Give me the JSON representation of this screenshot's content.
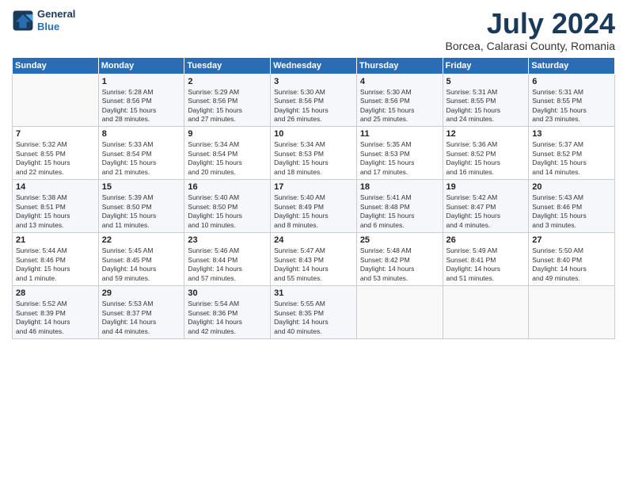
{
  "header": {
    "logo": {
      "line1": "General",
      "line2": "Blue"
    },
    "title": "July 2024",
    "subtitle": "Borcea, Calarasi County, Romania"
  },
  "weekdays": [
    "Sunday",
    "Monday",
    "Tuesday",
    "Wednesday",
    "Thursday",
    "Friday",
    "Saturday"
  ],
  "weeks": [
    [
      {
        "day": "",
        "info": ""
      },
      {
        "day": "1",
        "info": "Sunrise: 5:28 AM\nSunset: 8:56 PM\nDaylight: 15 hours\nand 28 minutes."
      },
      {
        "day": "2",
        "info": "Sunrise: 5:29 AM\nSunset: 8:56 PM\nDaylight: 15 hours\nand 27 minutes."
      },
      {
        "day": "3",
        "info": "Sunrise: 5:30 AM\nSunset: 8:56 PM\nDaylight: 15 hours\nand 26 minutes."
      },
      {
        "day": "4",
        "info": "Sunrise: 5:30 AM\nSunset: 8:56 PM\nDaylight: 15 hours\nand 25 minutes."
      },
      {
        "day": "5",
        "info": "Sunrise: 5:31 AM\nSunset: 8:55 PM\nDaylight: 15 hours\nand 24 minutes."
      },
      {
        "day": "6",
        "info": "Sunrise: 5:31 AM\nSunset: 8:55 PM\nDaylight: 15 hours\nand 23 minutes."
      }
    ],
    [
      {
        "day": "7",
        "info": "Sunrise: 5:32 AM\nSunset: 8:55 PM\nDaylight: 15 hours\nand 22 minutes."
      },
      {
        "day": "8",
        "info": "Sunrise: 5:33 AM\nSunset: 8:54 PM\nDaylight: 15 hours\nand 21 minutes."
      },
      {
        "day": "9",
        "info": "Sunrise: 5:34 AM\nSunset: 8:54 PM\nDaylight: 15 hours\nand 20 minutes."
      },
      {
        "day": "10",
        "info": "Sunrise: 5:34 AM\nSunset: 8:53 PM\nDaylight: 15 hours\nand 18 minutes."
      },
      {
        "day": "11",
        "info": "Sunrise: 5:35 AM\nSunset: 8:53 PM\nDaylight: 15 hours\nand 17 minutes."
      },
      {
        "day": "12",
        "info": "Sunrise: 5:36 AM\nSunset: 8:52 PM\nDaylight: 15 hours\nand 16 minutes."
      },
      {
        "day": "13",
        "info": "Sunrise: 5:37 AM\nSunset: 8:52 PM\nDaylight: 15 hours\nand 14 minutes."
      }
    ],
    [
      {
        "day": "14",
        "info": "Sunrise: 5:38 AM\nSunset: 8:51 PM\nDaylight: 15 hours\nand 13 minutes."
      },
      {
        "day": "15",
        "info": "Sunrise: 5:39 AM\nSunset: 8:50 PM\nDaylight: 15 hours\nand 11 minutes."
      },
      {
        "day": "16",
        "info": "Sunrise: 5:40 AM\nSunset: 8:50 PM\nDaylight: 15 hours\nand 10 minutes."
      },
      {
        "day": "17",
        "info": "Sunrise: 5:40 AM\nSunset: 8:49 PM\nDaylight: 15 hours\nand 8 minutes."
      },
      {
        "day": "18",
        "info": "Sunrise: 5:41 AM\nSunset: 8:48 PM\nDaylight: 15 hours\nand 6 minutes."
      },
      {
        "day": "19",
        "info": "Sunrise: 5:42 AM\nSunset: 8:47 PM\nDaylight: 15 hours\nand 4 minutes."
      },
      {
        "day": "20",
        "info": "Sunrise: 5:43 AM\nSunset: 8:46 PM\nDaylight: 15 hours\nand 3 minutes."
      }
    ],
    [
      {
        "day": "21",
        "info": "Sunrise: 5:44 AM\nSunset: 8:46 PM\nDaylight: 15 hours\nand 1 minute."
      },
      {
        "day": "22",
        "info": "Sunrise: 5:45 AM\nSunset: 8:45 PM\nDaylight: 14 hours\nand 59 minutes."
      },
      {
        "day": "23",
        "info": "Sunrise: 5:46 AM\nSunset: 8:44 PM\nDaylight: 14 hours\nand 57 minutes."
      },
      {
        "day": "24",
        "info": "Sunrise: 5:47 AM\nSunset: 8:43 PM\nDaylight: 14 hours\nand 55 minutes."
      },
      {
        "day": "25",
        "info": "Sunrise: 5:48 AM\nSunset: 8:42 PM\nDaylight: 14 hours\nand 53 minutes."
      },
      {
        "day": "26",
        "info": "Sunrise: 5:49 AM\nSunset: 8:41 PM\nDaylight: 14 hours\nand 51 minutes."
      },
      {
        "day": "27",
        "info": "Sunrise: 5:50 AM\nSunset: 8:40 PM\nDaylight: 14 hours\nand 49 minutes."
      }
    ],
    [
      {
        "day": "28",
        "info": "Sunrise: 5:52 AM\nSunset: 8:39 PM\nDaylight: 14 hours\nand 46 minutes."
      },
      {
        "day": "29",
        "info": "Sunrise: 5:53 AM\nSunset: 8:37 PM\nDaylight: 14 hours\nand 44 minutes."
      },
      {
        "day": "30",
        "info": "Sunrise: 5:54 AM\nSunset: 8:36 PM\nDaylight: 14 hours\nand 42 minutes."
      },
      {
        "day": "31",
        "info": "Sunrise: 5:55 AM\nSunset: 8:35 PM\nDaylight: 14 hours\nand 40 minutes."
      },
      {
        "day": "",
        "info": ""
      },
      {
        "day": "",
        "info": ""
      },
      {
        "day": "",
        "info": ""
      }
    ]
  ]
}
